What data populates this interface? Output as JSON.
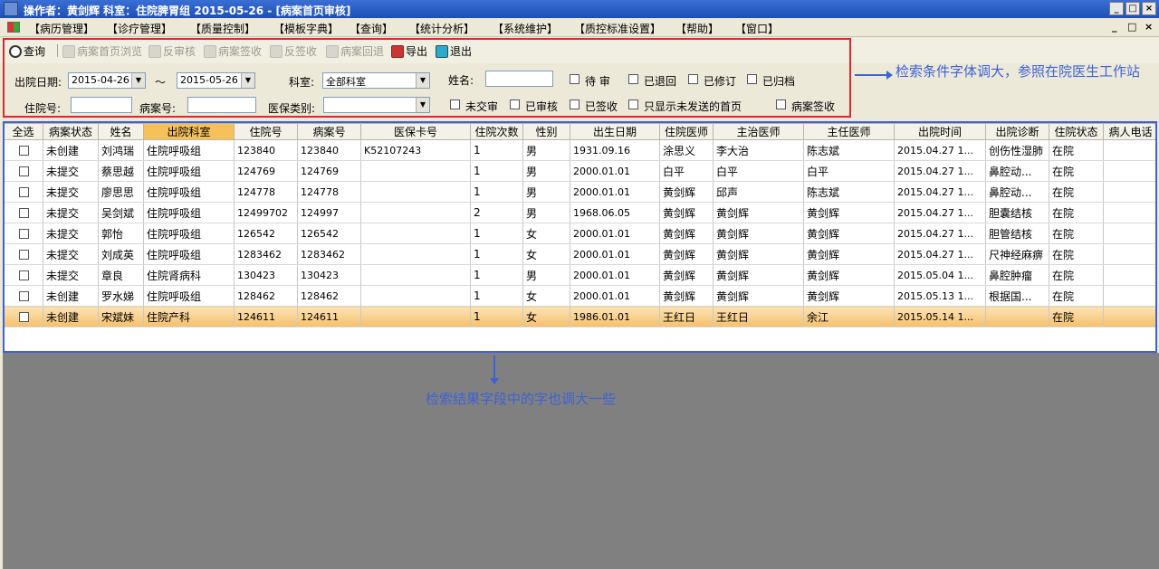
{
  "window": {
    "title": "操作者：黄剑辉   科室：住院脾胃组   2015-05-26 - [病案首页审核]",
    "controls": [
      "_",
      "□",
      "×"
    ]
  },
  "menu": {
    "items": [
      "【病历管理】",
      "【诊疗管理】",
      "【质量控制】",
      "【模板字典】",
      "【查询】",
      "【统计分析】",
      "【系统维护】",
      "【质控标准设置】",
      "【帮助】",
      "【窗口】"
    ],
    "mdi_controls": [
      "_",
      "□",
      "×"
    ]
  },
  "toolbar": {
    "items": [
      {
        "label": "查询",
        "icon": "magnifier-icon",
        "enabled": true
      },
      {
        "label": "病案首页浏览",
        "icon": "document-icon",
        "enabled": false
      },
      {
        "label": "反审核",
        "icon": "undo-review-icon",
        "enabled": false
      },
      {
        "label": "病案签收",
        "icon": "signoff-icon",
        "enabled": false
      },
      {
        "label": "反签收",
        "icon": "undo-signoff-icon",
        "enabled": false
      },
      {
        "label": "病案回退",
        "icon": "return-icon",
        "enabled": false
      },
      {
        "label": "导出",
        "icon": "export-icon",
        "enabled": true
      },
      {
        "label": "退出",
        "icon": "exit-icon",
        "enabled": true
      }
    ]
  },
  "search": {
    "discharge_date_label": "出院日期:",
    "date_from": "2015-04-26",
    "tilde": "～",
    "date_to": "2015-05-26",
    "dept_label": "科室:",
    "dept_value": "全部科室",
    "name_label": "姓名:",
    "name_value": "",
    "checks_row1": [
      "待  审",
      "已退回",
      "已修订",
      "已归档"
    ],
    "inpatient_no_label": "住院号:",
    "inpatient_no_value": "",
    "record_no_label": "病案号:",
    "record_no_value": "",
    "insurance_label": "医保类别:",
    "insurance_value": "",
    "checks_row2": [
      "未交审",
      "已审核",
      "已签收",
      "只显示未发送的首页",
      "病案签收"
    ]
  },
  "annotations": {
    "search_note": "检索条件字体调大，参照在院医生工作站",
    "result_note": "检索结果字段中的字也调大一些"
  },
  "grid": {
    "columns": [
      "全选",
      "病案状态",
      "姓名",
      "出院科室",
      "住院号",
      "病案号",
      "医保卡号",
      "住院次数",
      "性别",
      "出生日期",
      "住院医师",
      "主治医师",
      "主任医师",
      "出院时间",
      "出院诊断",
      "住院状态",
      "病人电话"
    ],
    "sorted_column": 3,
    "rows": [
      [
        "",
        "未创建",
        "刘鸿瑞",
        "住院呼吸组",
        "123840",
        "123840",
        "K52107243",
        "1",
        "男",
        "1931.09.16",
        "涂思义",
        "李大治",
        "陈志斌",
        "2015.04.27 1...",
        "创伤性湿肺",
        "在院",
        ""
      ],
      [
        "",
        "未提交",
        "蔡思越",
        "住院呼吸组",
        "124769",
        "124769",
        "",
        "1",
        "男",
        "2000.01.01",
        "白平",
        "白平",
        "白平",
        "2015.04.27 1...",
        "鼻腔动...",
        "在院",
        ""
      ],
      [
        "",
        "未提交",
        "廖思思",
        "住院呼吸组",
        "124778",
        "124778",
        "",
        "1",
        "男",
        "2000.01.01",
        "黄剑辉",
        "邱声",
        "陈志斌",
        "2015.04.27 1...",
        "鼻腔动...",
        "在院",
        ""
      ],
      [
        "",
        "未提交",
        "吴剑斌",
        "住院呼吸组",
        "12499702",
        "124997",
        "",
        "2",
        "男",
        "1968.06.05",
        "黄剑辉",
        "黄剑辉",
        "黄剑辉",
        "2015.04.27 1...",
        "胆囊结核",
        "在院",
        ""
      ],
      [
        "",
        "未提交",
        "郭怡",
        "住院呼吸组",
        "126542",
        "126542",
        "",
        "1",
        "女",
        "2000.01.01",
        "黄剑辉",
        "黄剑辉",
        "黄剑辉",
        "2015.04.27 1...",
        "胆管结核",
        "在院",
        ""
      ],
      [
        "",
        "未提交",
        "刘成英",
        "住院呼吸组",
        "1283462",
        "1283462",
        "",
        "1",
        "女",
        "2000.01.01",
        "黄剑辉",
        "黄剑辉",
        "黄剑辉",
        "2015.04.27 1...",
        "尺神经麻痹",
        "在院",
        ""
      ],
      [
        "",
        "未提交",
        "章良",
        "住院肾病科",
        "130423",
        "130423",
        "",
        "1",
        "男",
        "2000.01.01",
        "黄剑辉",
        "黄剑辉",
        "黄剑辉",
        "2015.05.04 1...",
        "鼻腔肿瘤",
        "在院",
        ""
      ],
      [
        "",
        "未创建",
        "罗水娣",
        "住院呼吸组",
        "128462",
        "128462",
        "",
        "1",
        "女",
        "2000.01.01",
        "黄剑辉",
        "黄剑辉",
        "黄剑辉",
        "2015.05.13 1...",
        "根据国...",
        "在院",
        ""
      ],
      [
        "",
        "未创建",
        "宋斌妹",
        "住院产科",
        "124611",
        "124611",
        "",
        "1",
        "女",
        "1986.01.01",
        "王红日",
        "王红日",
        "余江",
        "2015.05.14 1...",
        "",
        "在院",
        ""
      ]
    ],
    "selected_row": 8
  }
}
